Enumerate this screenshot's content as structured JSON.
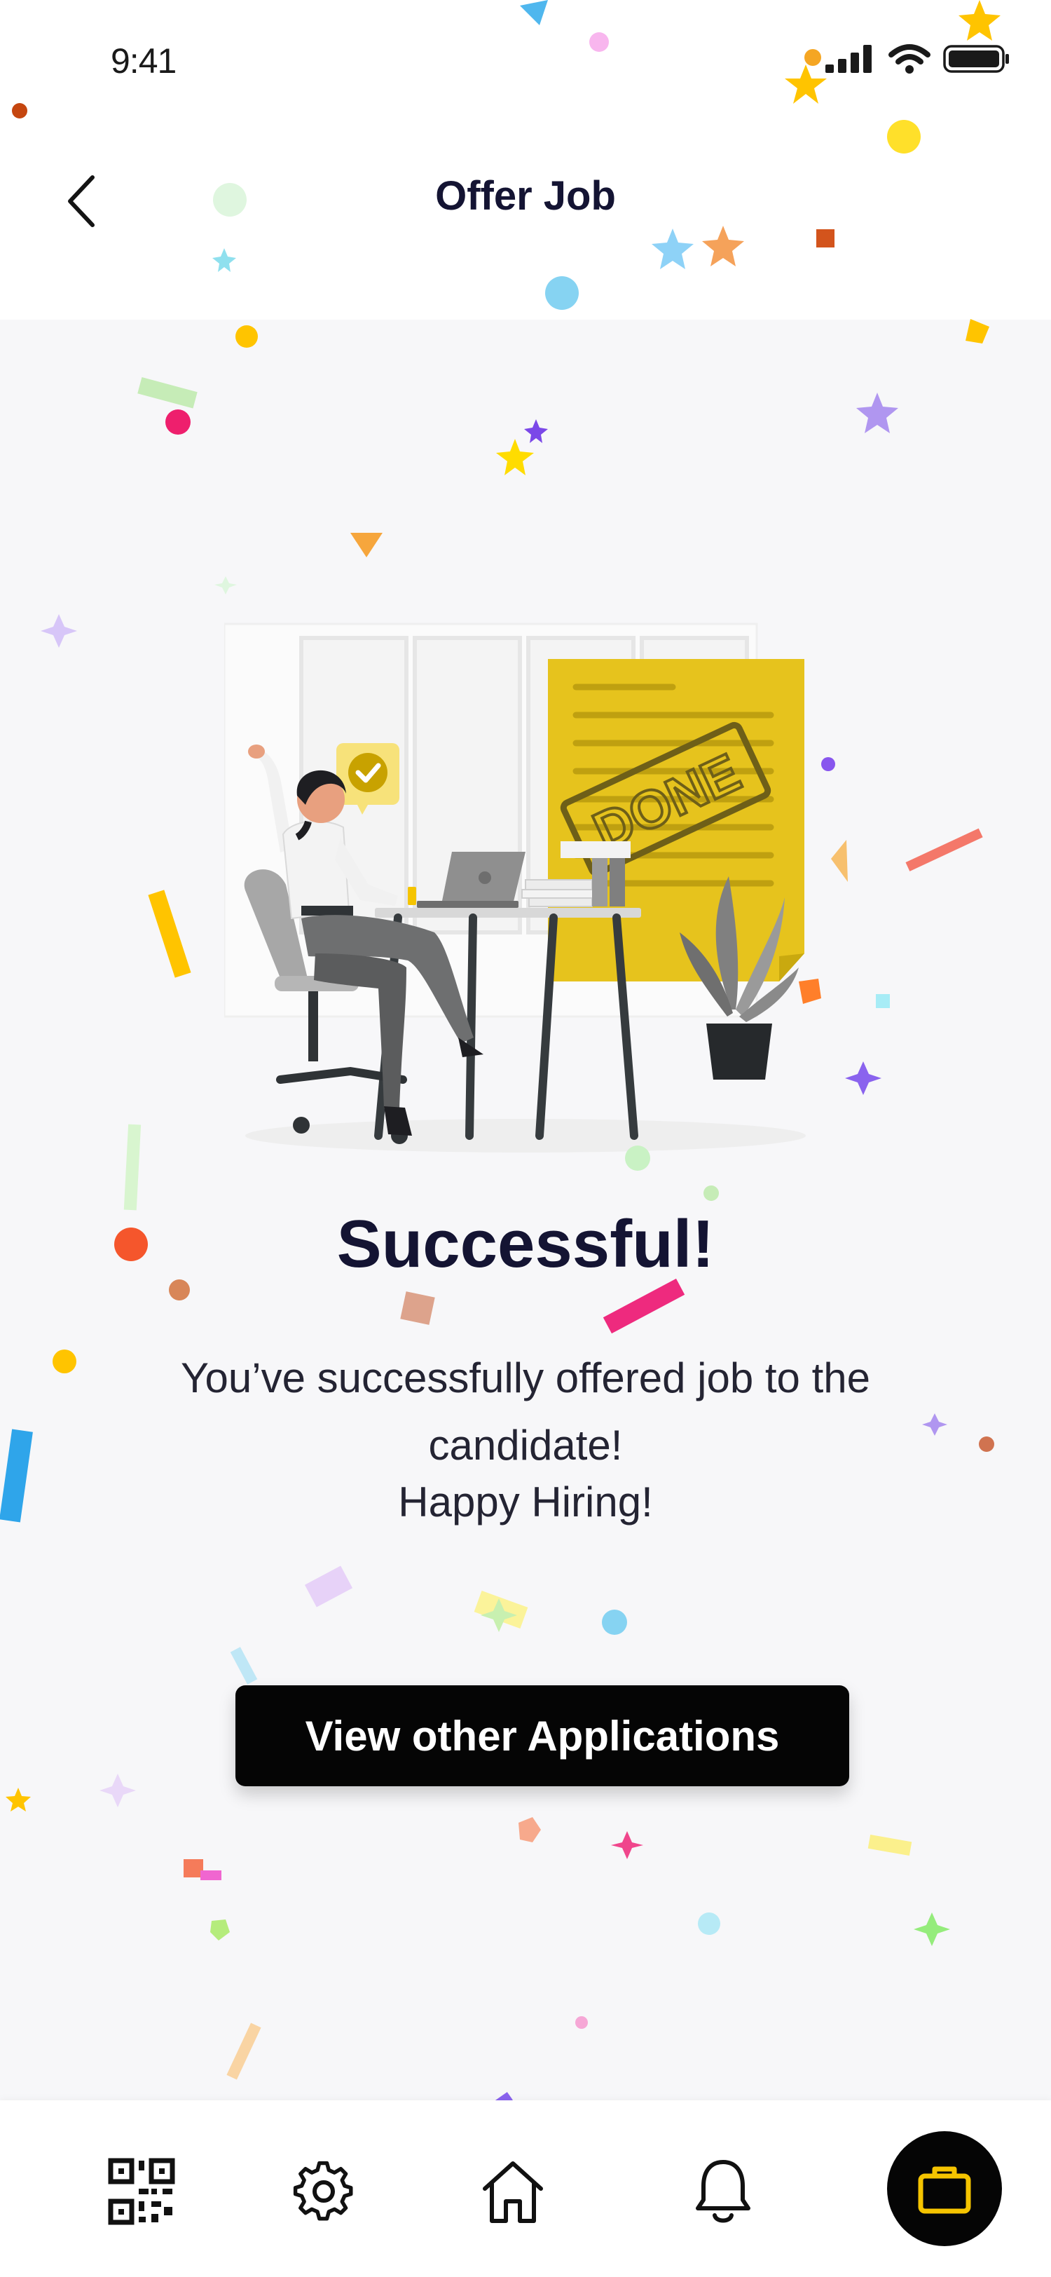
{
  "status_bar": {
    "time": "9:41"
  },
  "header": {
    "title": "Offer Job",
    "back_icon": "chevron-left-icon"
  },
  "main": {
    "illustration_stamp": "DONE",
    "title": "Successful!",
    "message": "You’ve successfully offered job to the candidate!",
    "sub_message": "Happy Hiring!",
    "primary_button": "View other Applications"
  },
  "bottom_nav": {
    "items": [
      "qr-code-icon",
      "gear-icon",
      "home-icon",
      "bell-icon",
      "briefcase-icon"
    ]
  },
  "colors": {
    "accent": "#f5c400",
    "primary_text": "#141433",
    "button_bg": "#050505",
    "doc_yellow": "#e6c31d"
  }
}
